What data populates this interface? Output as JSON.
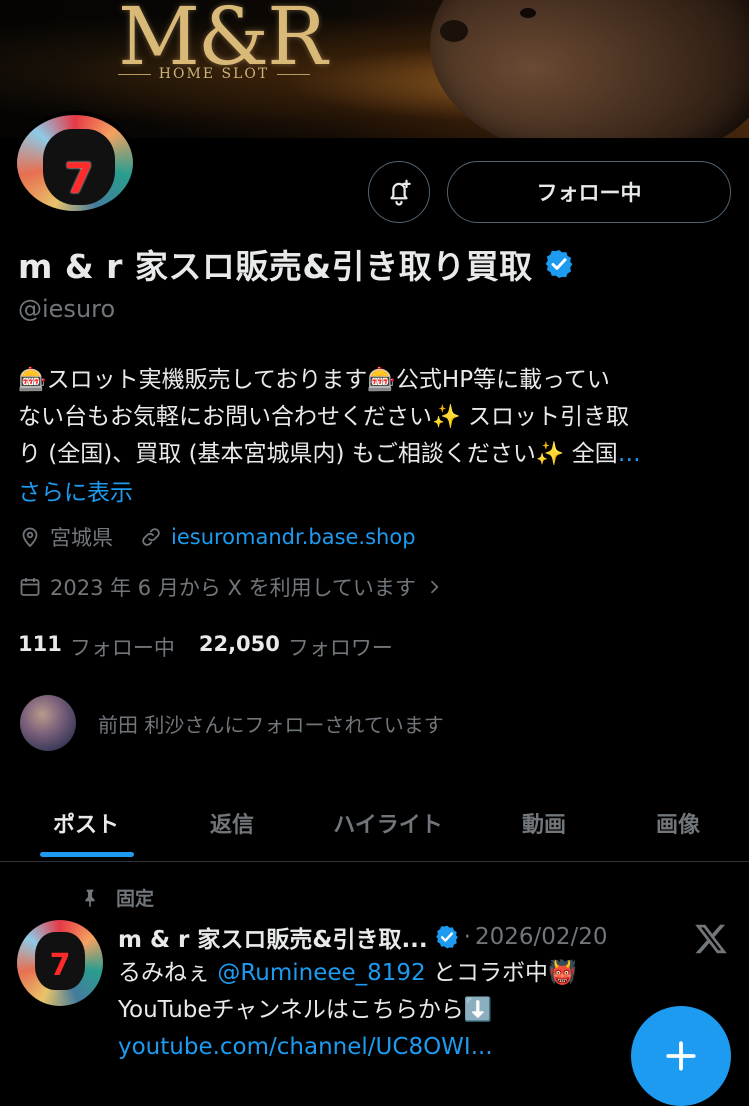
{
  "banner": {
    "logo_text": "M&R",
    "logo_subtext": "HOME SLOT"
  },
  "header": {
    "follow_label": "フォロー中"
  },
  "profile": {
    "display_name": "m & r 家スロ販売&引き取り買取",
    "handle": "@iesuro",
    "bio_lines": [
      "🎰スロット実機販売しております🎰公式HP等に載ってい",
      "ない台もお気軽にお問い合わせください✨ スロット引き取",
      "り (全国)、買取 (基本宮城県内) もご相談ください✨ 全国"
    ],
    "bio_ellipsis": "…",
    "show_more": "さらに表示",
    "location": "宮城県",
    "website": "iesuromandr.base.shop",
    "joined": "2023 年 6 月から X を利用しています",
    "following_count": "111",
    "following_label": "フォロー中",
    "followers_count": "22,050",
    "followers_label": "フォロワー",
    "followed_by_text": "前田 利沙さんにフォローされています"
  },
  "tabs": [
    {
      "label": "ポスト"
    },
    {
      "label": "返信"
    },
    {
      "label": "ハイライト"
    },
    {
      "label": "動画"
    },
    {
      "label": "画像"
    }
  ],
  "pinned_post": {
    "pinned_label": "固定",
    "author_name": "m & r 家スロ販売&引き取...",
    "dot": "·",
    "date": "2026/02/20",
    "line1_prefix": "るみねぇ ",
    "line1_mention": "@Rumineee_8192",
    "line1_suffix": " とコラボ中👹",
    "line2": "YouTubeチャンネルはこちらから⬇️",
    "line3_link": "youtube.com/channel/UC8OWI..."
  },
  "colors": {
    "accent": "#1d9bf0",
    "muted": "#71767b",
    "text": "#e7e9ea",
    "background": "#000000"
  },
  "icons": [
    "notification-bell-icon",
    "verified-badge-icon",
    "location-pin-icon",
    "link-icon",
    "calendar-icon",
    "chevron-right-icon",
    "pin-icon",
    "x-logo-icon",
    "plus-icon"
  ]
}
